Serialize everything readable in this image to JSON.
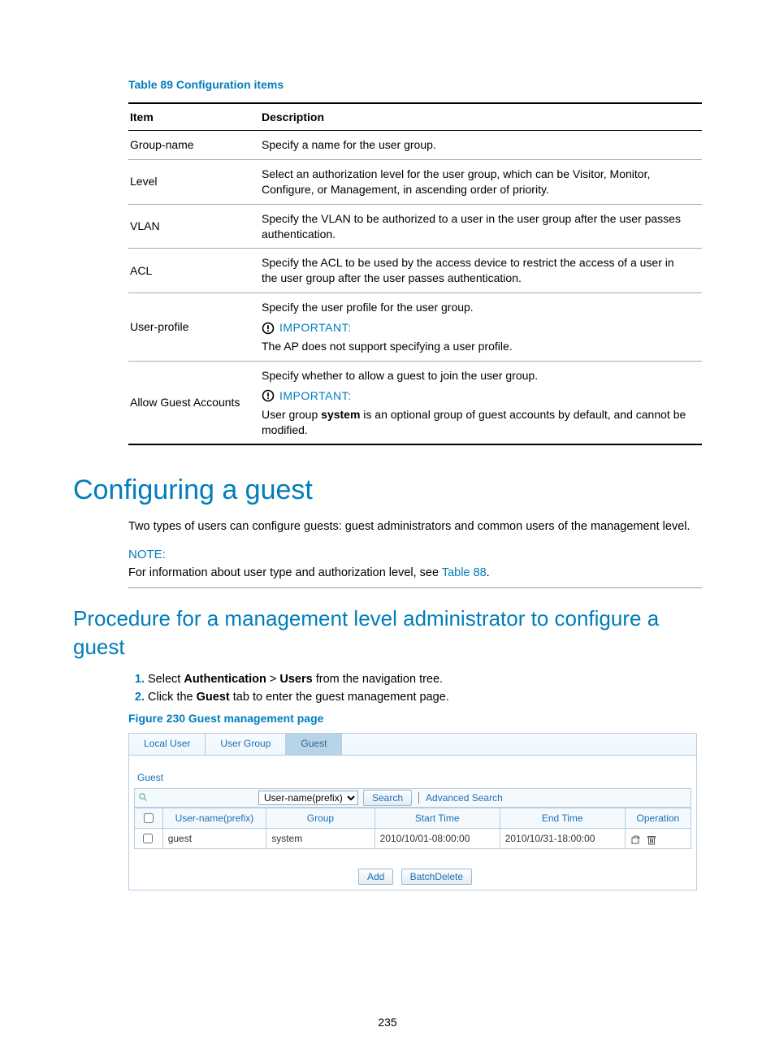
{
  "table89": {
    "caption": "Table 89 Configuration items",
    "headers": {
      "item": "Item",
      "desc": "Description"
    },
    "rows": {
      "groupname": {
        "item": "Group-name",
        "desc": "Specify a name for the user group."
      },
      "level": {
        "item": "Level",
        "desc": "Select an authorization level for the user group, which can be Visitor, Monitor, Configure, or Management, in ascending order of priority."
      },
      "vlan": {
        "item": "VLAN",
        "desc": "Specify the VLAN to be authorized to a user in the user group after the user passes authentication."
      },
      "acl": {
        "item": "ACL",
        "desc": "Specify the ACL to be used by the access device to restrict the access of a user in the user group after the user passes authentication."
      },
      "userprofile": {
        "item": "User-profile",
        "line1": "Specify the user profile for the user group.",
        "important": "IMPORTANT:",
        "line2": "The AP does not support specifying a user profile."
      },
      "allowguest": {
        "item": "Allow Guest Accounts",
        "line1": "Specify whether to allow a guest to join the user group.",
        "important": "IMPORTANT:",
        "line2a": "User group ",
        "line2b": "system",
        "line2c": " is an optional group of guest accounts by default, and cannot be modified."
      }
    }
  },
  "section": {
    "h1": "Configuring a guest",
    "intro": "Two types of users can configure guests: guest administrators and common users of the management level.",
    "note_label": "NOTE:",
    "note_text_a": "For information about user type and authorization level, see ",
    "note_link": "Table 88",
    "note_text_b": "."
  },
  "subsection": {
    "h2": "Procedure for a management level administrator to configure a guest",
    "step1a": "Select ",
    "step1b": "Authentication",
    "step1c": " > ",
    "step1d": "Users",
    "step1e": " from the navigation tree.",
    "step2a": "Click the ",
    "step2b": "Guest",
    "step2c": " tab to enter the guest management page.",
    "figcap": "Figure 230 Guest management page"
  },
  "ui": {
    "tabs": {
      "local": "Local User",
      "group": "User Group",
      "guest": "Guest"
    },
    "panel_title": "Guest",
    "select_option": "User-name(prefix)",
    "search_btn": "Search",
    "adv": "Advanced Search",
    "cols": {
      "user": "User-name(prefix)",
      "group": "Group",
      "start": "Start Time",
      "end": "End Time",
      "op": "Operation"
    },
    "row": {
      "user": "guest",
      "group": "system",
      "start": "2010/10/01-08:00:00",
      "end": "2010/10/31-18:00:00"
    },
    "add_btn": "Add",
    "batch_btn": "BatchDelete"
  },
  "page_number": "235"
}
